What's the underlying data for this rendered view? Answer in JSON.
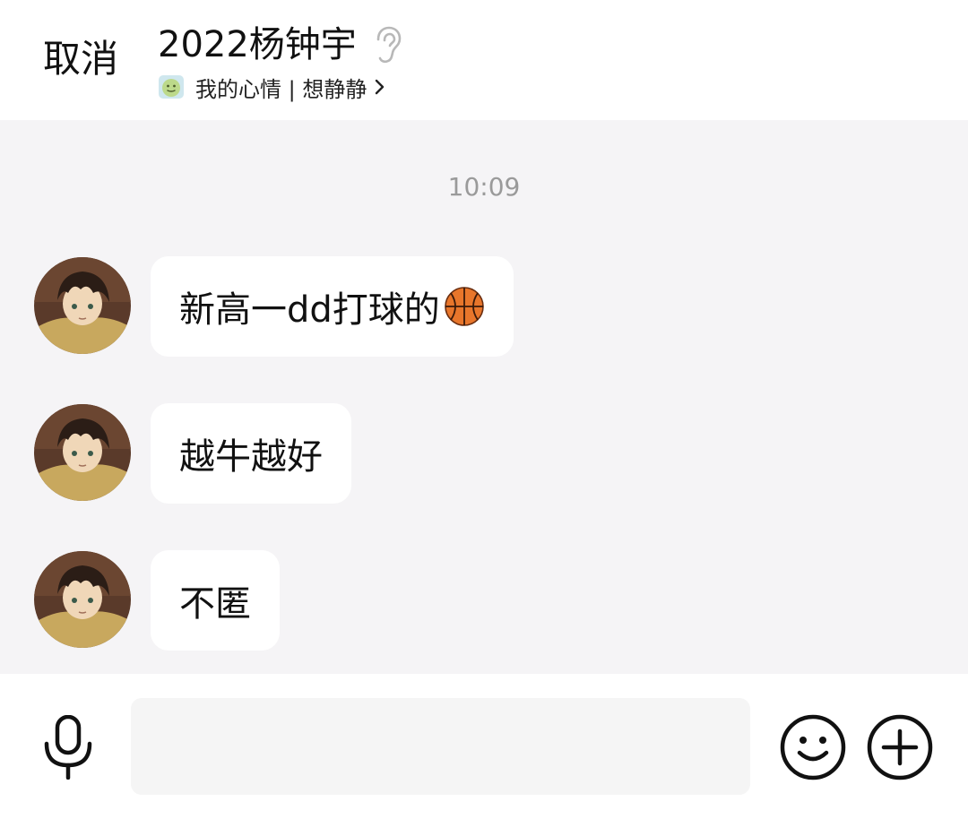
{
  "header": {
    "cancel_label": "取消",
    "title": "2022杨钟宇",
    "status_icon": "mood-face-icon",
    "status_text": "我的心情 | 想静静",
    "title_icon": "ear-icon"
  },
  "chat": {
    "timestamp": "10:09",
    "messages": [
      {
        "sender": "contact",
        "text": "新高一dd打球的",
        "emoji": "basketball-icon"
      },
      {
        "sender": "contact",
        "text": "越牛越好"
      },
      {
        "sender": "contact",
        "text": "不匿"
      }
    ]
  },
  "input_bar": {
    "input_value": "",
    "placeholder": "",
    "voice_icon": "microphone-icon",
    "emoji_icon": "smiley-icon",
    "more_icon": "plus-circle-icon"
  },
  "colors": {
    "chat_background": "#f5f4f6",
    "bubble": "#ffffff",
    "timestamp": "#9a9a9a",
    "input_field": "#f5f5f5"
  }
}
